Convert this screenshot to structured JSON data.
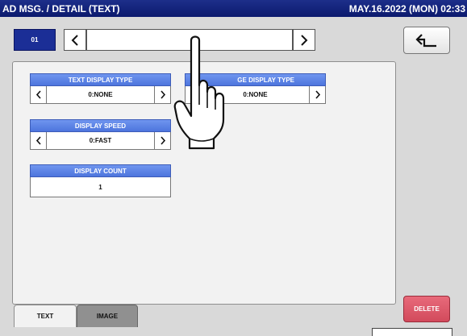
{
  "header": {
    "title": "AD MSG. / DETAIL (TEXT)",
    "datetime": "MAY.16.2022 (MON) 02:33"
  },
  "record": {
    "number": "01",
    "value": ""
  },
  "settings": {
    "text_display_type": {
      "label": "TEXT DISPLAY TYPE",
      "value": "0:NONE"
    },
    "image_display_type": {
      "label": "GE DISPLAY TYPE",
      "value": "0:NONE"
    },
    "display_speed": {
      "label": "DISPLAY SPEED",
      "value": "0:FAST"
    },
    "display_count": {
      "label": "DISPLAY COUNT",
      "value": "1"
    }
  },
  "tabs": [
    {
      "label": "TEXT",
      "active": true
    },
    {
      "label": "IMAGE",
      "active": false
    }
  ],
  "buttons": {
    "delete": "DELETE"
  },
  "icons": {
    "back": "return-arrow-icon",
    "prev": "chevron-left-icon",
    "next": "chevron-right-icon",
    "pointer": "pointing-hand-icon"
  },
  "colors": {
    "title_bar": "#0b1a6e",
    "setting_header": "#5a80e6",
    "record_number": "#1b2e96",
    "delete": "#d95466"
  }
}
